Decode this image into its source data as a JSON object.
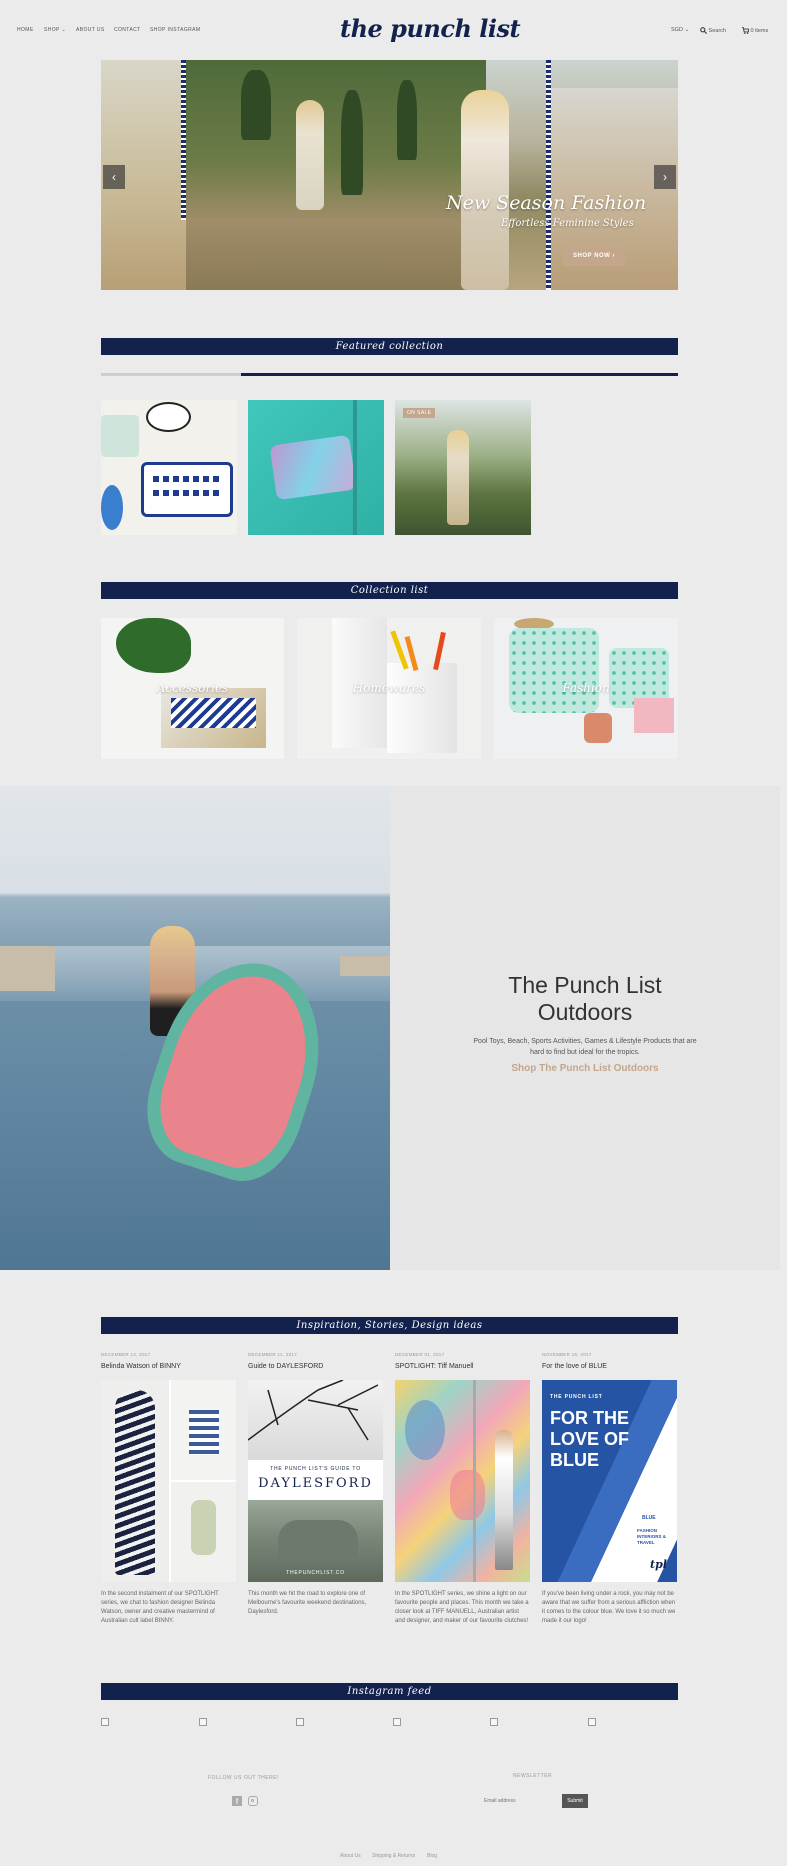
{
  "header": {
    "nav": [
      "HOME",
      "SHOP",
      "ABOUT US",
      "CONTACT",
      "SHOP INSTAGRAM"
    ],
    "logo": "the punch list",
    "currency": "SGD",
    "search": "Search",
    "cart": "0 items"
  },
  "hero": {
    "title": "New Season Fashion",
    "subtitle": "Effortless Feminine Styles",
    "button": "SHOP NOW",
    "prev": "‹",
    "next": "›"
  },
  "featured": {
    "heading": "Featured collection",
    "sale_badge": "ON SALE"
  },
  "collections": {
    "heading": "Collection list",
    "items": [
      "Accessories",
      "Homewares",
      "Fashion"
    ]
  },
  "outdoors": {
    "title_line1": "The Punch List",
    "title_line2": "Outdoors",
    "description": "Pool Toys, Beach, Sports Activities, Games & Lifestyle Products that are hard to find but ideal for the tropics.",
    "link": "Shop The Punch List Outdoors"
  },
  "blog": {
    "heading": "Inspiration, Stories, Design ideas",
    "posts": [
      {
        "date": "DECEMBER 14, 2017",
        "title": "Belinda Watson of BINNY",
        "excerpt": "In the second instalment of our SPOTLIGHT series, we chat to fashion designer Belinda Watson, owner and creative mastermind of Australian cult label BINNY."
      },
      {
        "date": "DECEMBER 11, 2017",
        "title": "Guide to DAYLESFORD",
        "excerpt": "This month we hit the road to explore one of Melbourne's favourite weekend destinations, Daylesford.",
        "img_text1": "THE PUNCH LIST'S GUIDE TO",
        "img_text2": "DAYLESFORD",
        "img_text3": "THEPUNCHLIST.CO"
      },
      {
        "date": "DECEMBER 01, 2017",
        "title": "SPOTLIGHT: Tiff Manuell",
        "excerpt": "In the SPOTLIGHT series, we shine a light on our favourite people and places. This month we take a closer look at TIFF MANUELL, Australian artist and designer, and maker of our favourite clutches!"
      },
      {
        "date": "NOVEMBER 15, 2017",
        "title": "For the love of BLUE",
        "excerpt": "If you've been living under a rock, you may not be aware that we suffer from a serious affliction when it comes to the colour blue. We love it so much we made it our logo!",
        "img_text1": "THE PUNCH LIST",
        "img_text2": "FOR THE LOVE OF BLUE",
        "img_text3": "BLUE",
        "img_text4": "FASHION INTERIORS & TRAVEL",
        "img_text5": "tpl"
      }
    ]
  },
  "instagram": {
    "heading": "Instagram feed"
  },
  "footer": {
    "follow": "FOLLOW US OUT THERE!",
    "newsletter": "NEWSLETTER",
    "email_placeholder": "Email address",
    "submit": "Submit",
    "links": [
      "About Us",
      "Shipping & Returns",
      "Blog"
    ]
  },
  "colors": {
    "navy": "#13224d",
    "accent": "#c4a68a",
    "background": "#ebebeb"
  }
}
